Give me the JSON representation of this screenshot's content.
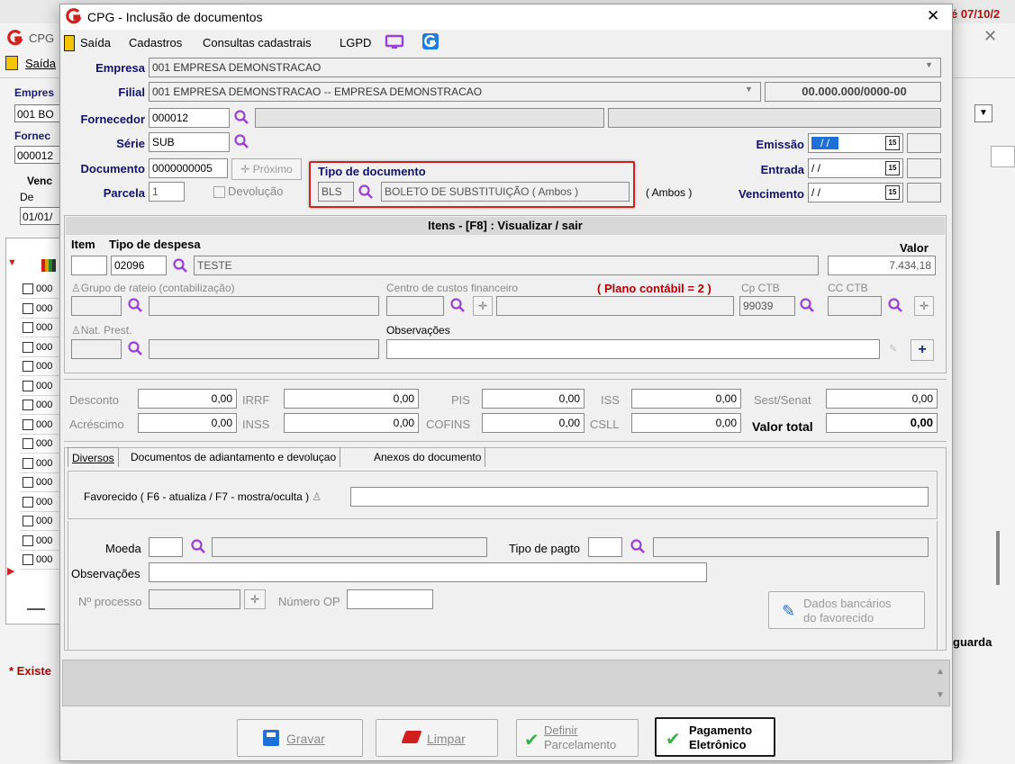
{
  "background": {
    "title": "CPG",
    "menu_saida": "Saída",
    "label_empresa": "Empres",
    "value_empresa": "001 BO",
    "label_fornecedor": "Fornec",
    "value_fornecedor": "000012",
    "label_venc": "Venc",
    "label_de": "De",
    "value_de": "01/01/",
    "right_date": "é 07/10/2",
    "label_guarda": "guarda",
    "label_existe": "* Existe",
    "row_prefix": "000",
    "row_count": 15
  },
  "dialog": {
    "title": "CPG - Inclusão de documentos",
    "menu": [
      "Saída",
      "Cadastros",
      "Consultas cadastrais",
      "LGPD"
    ],
    "empresa": {
      "label": "Empresa",
      "value": "001 EMPRESA DEMONSTRACAO"
    },
    "filial": {
      "label": "Filial",
      "value": "001 EMPRESA DEMONSTRACAO -- EMPRESA DEMONSTRACAO",
      "cnpj": "00.000.000/0000-00"
    },
    "fornecedor": {
      "label": "Fornecedor",
      "value": "000012"
    },
    "serie": {
      "label": "Série",
      "value": "SUB"
    },
    "documento": {
      "label": "Documento",
      "value": "0000000005",
      "proximo": "Próximo"
    },
    "parcela": {
      "label": "Parcela",
      "value": "1",
      "devolucao": "Devolução"
    },
    "tipo_documento": {
      "label": "Tipo de documento",
      "code": "BLS",
      "description": "BOLETO DE SUBSTITUIÇÃO ( Ambos )",
      "suffix": "( Ambos )"
    },
    "emissao": {
      "label": "Emissão",
      "value": " / /"
    },
    "entrada": {
      "label": "Entrada",
      "value": " / /"
    },
    "vencimento": {
      "label": "Vencimento",
      "value": " / /"
    },
    "calendar_icon_text": "15",
    "itens": {
      "header": "Itens  - [F8] : Visualizar / sair",
      "item_label": "Item",
      "tipo_despesa_label": "Tipo de despesa",
      "valor_label": "Valor",
      "tipo_despesa_code": "02096",
      "tipo_despesa_desc": "TESTE",
      "valor": "7.434,18",
      "grupo_rateio": "Grupo de rateio (contabilização)",
      "centro_custos": "Centro de custos financeiro",
      "plano_contabil": "( Plano contábil = 2 )",
      "cp_ctb_label": "Cp CTB",
      "cp_ctb_value": "99039",
      "cc_ctb_label": "CC CTB",
      "nat_prest": "Nat. Prest.",
      "observacoes": "Observações"
    },
    "totais": {
      "desconto": "Desconto",
      "desconto_v": "0,00",
      "irrf": "IRRF",
      "irrf_v": "0,00",
      "pis": "PIS",
      "pis_v": "0,00",
      "iss": "ISS",
      "iss_v": "0,00",
      "sest": "Sest/Senat",
      "sest_v": "0,00",
      "acrescimo": "Acréscimo",
      "acrescimo_v": "0,00",
      "inss": "INSS",
      "inss_v": "0,00",
      "cofins": "COFINS",
      "cofins_v": "0,00",
      "csll": "CSLL",
      "csll_v": "0,00",
      "valor_total": "Valor total",
      "valor_total_v": "0,00"
    },
    "tabs": [
      "Diversos",
      "Documentos de adiantamento e devoluçao",
      "Anexos do documento"
    ],
    "diversos": {
      "favorecido": "Favorecido ( F6 - atualiza / F7 - mostra/oculta )",
      "moeda": "Moeda",
      "tipo_pagto": "Tipo de pagto",
      "observacoes": "Observações",
      "nr_processo": "Nº processo",
      "numero_op": "Número OP",
      "dados_bancarios_1": "Dados bancários",
      "dados_bancarios_2": "do favorecido"
    },
    "buttons": {
      "gravar": "Gravar",
      "limpar": "Limpar",
      "definir_1": "Definir",
      "definir_2": "Parcelamento",
      "pagamento_1": "Pagamento",
      "pagamento_2": "Eletrônico"
    },
    "colors": {
      "label": "#12126a",
      "accent_purple": "#9b3fd8",
      "highlight_red": "#d0201f",
      "plano_red": "#b00000"
    }
  }
}
